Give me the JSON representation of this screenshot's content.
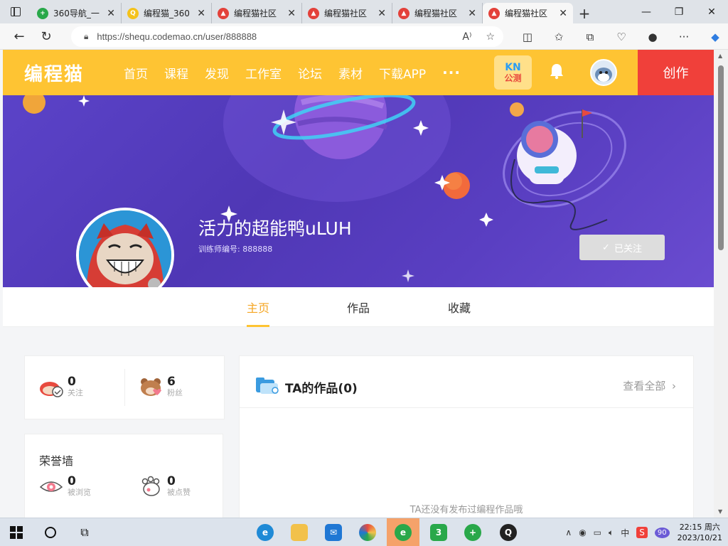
{
  "browser": {
    "tabs": [
      {
        "title": "360导航_一",
        "active": false,
        "favicon_color": "#29a84a"
      },
      {
        "title": "编程猫_360",
        "active": false,
        "favicon_color": "#f4c21b"
      },
      {
        "title": "编程猫社区",
        "active": false,
        "favicon_color": "#e3413a"
      },
      {
        "title": "编程猫社区",
        "active": false,
        "favicon_color": "#e3413a"
      },
      {
        "title": "编程猫社区",
        "active": false,
        "favicon_color": "#e3413a"
      },
      {
        "title": "编程猫社区",
        "active": true,
        "favicon_color": "#e3413a"
      }
    ],
    "url": "https://shequ.codemao.cn/user/888888"
  },
  "site": {
    "logo": "编程猫",
    "nav": [
      "首页",
      "课程",
      "发现",
      "工作室",
      "论坛",
      "素材",
      "下载APP"
    ],
    "more": "···",
    "kn_top": "KN",
    "kn_bottom": "公测",
    "create": "创作",
    "brand_color": "#fec433",
    "create_color": "#f0403a"
  },
  "profile": {
    "username": "活力的超能鸭uLUH",
    "trainer_id": "训练师编号: 888888",
    "follow_label": "已关注",
    "tabs": [
      "主页",
      "作品",
      "收藏"
    ],
    "active_tab": "主页"
  },
  "stats": {
    "following": {
      "value": "0",
      "label": "关注"
    },
    "fans": {
      "value": "6",
      "label": "粉丝"
    }
  },
  "honor": {
    "title": "荣誉墙",
    "views": {
      "value": "0",
      "label": "被浏览"
    },
    "likes": {
      "value": "0",
      "label": "被点赞"
    }
  },
  "works": {
    "title": "TA的作品(0)",
    "view_all": "查看全部",
    "empty": "TA还没有发布过编程作品哦"
  },
  "taskbar": {
    "time": "22:15 周六",
    "date": "2023/10/21",
    "ime": "中",
    "badge": "90"
  }
}
